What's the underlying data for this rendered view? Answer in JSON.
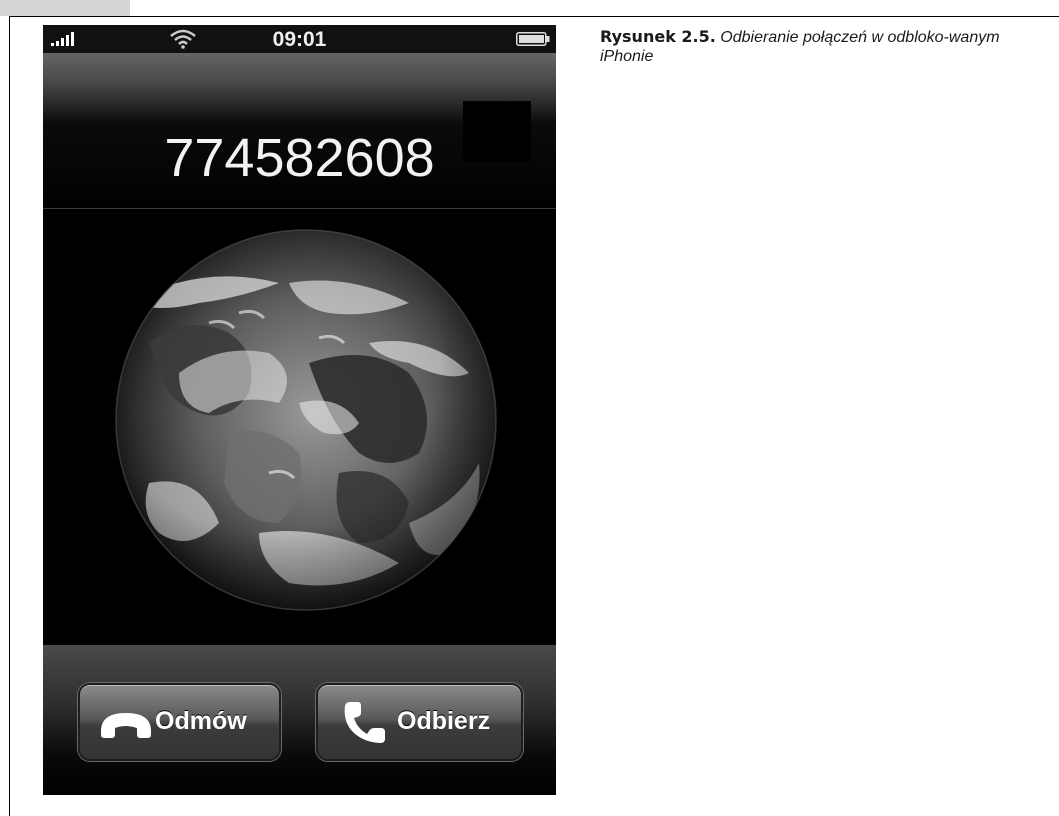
{
  "status_bar": {
    "time": "09:01",
    "signal_icon": "signal-bars-icon",
    "wifi_icon": "wifi-icon",
    "battery_icon": "battery-icon"
  },
  "caller": {
    "number": "774582608"
  },
  "wallpaper": {
    "image": "earth-globe"
  },
  "actions": {
    "decline_label": "Odmów",
    "decline_icon": "hang-up-icon",
    "answer_label": "Odbierz",
    "answer_icon": "phone-handset-icon"
  },
  "figure_caption": {
    "label": "Rysunek 2.5.",
    "text": "Odbieranie połączeń w odbloko-wanym iPhonie"
  },
  "colors": {
    "screen_background": "#000000",
    "button_text": "#ffffff"
  }
}
